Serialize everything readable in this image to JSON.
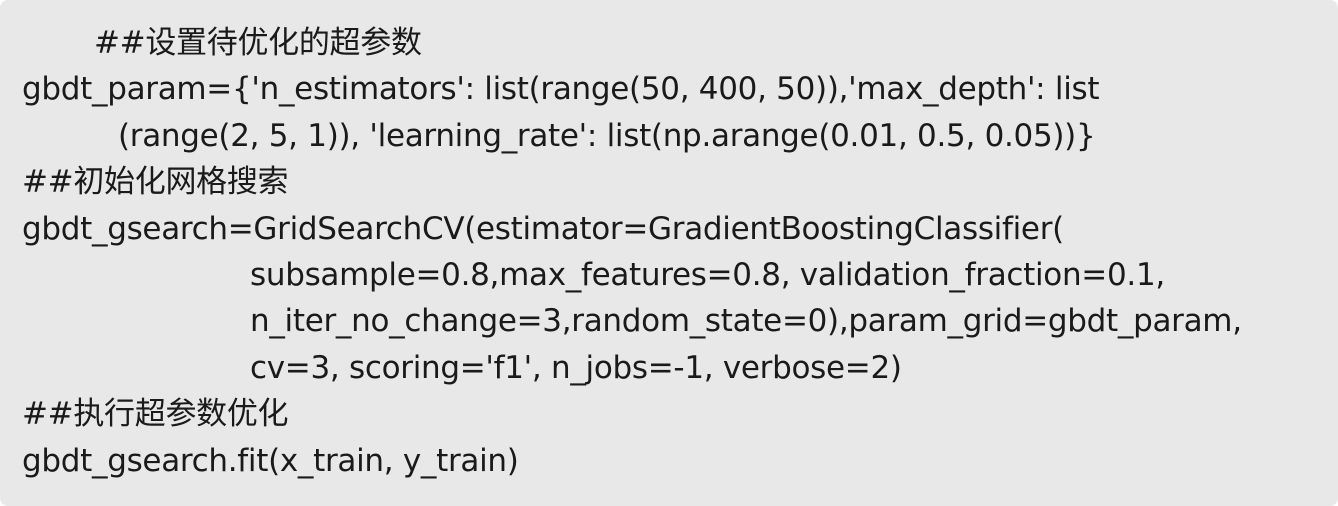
{
  "code": {
    "lines": [
      "##设置待优化的超参数",
      "gbdt_param={'n_estimators': list(range(50, 400, 50)),'max_depth': list",
      "(range(2, 5, 1)), 'learning_rate': list(np.arange(0.01, 0.5, 0.05))}",
      "##初始化网格搜索",
      "gbdt_gsearch=GridSearchCV(estimator=GradientBoostingClassifier(",
      "subsample=0.8,max_features=0.8, validation_fraction=0.1,",
      "n_iter_no_change=3,random_state=0),param_grid=gbdt_param,",
      "cv=3, scoring='f1', n_jobs=-1, verbose=2)",
      "##执行超参数优化",
      "gbdt_gsearch.fit(x_train, y_train)"
    ]
  }
}
